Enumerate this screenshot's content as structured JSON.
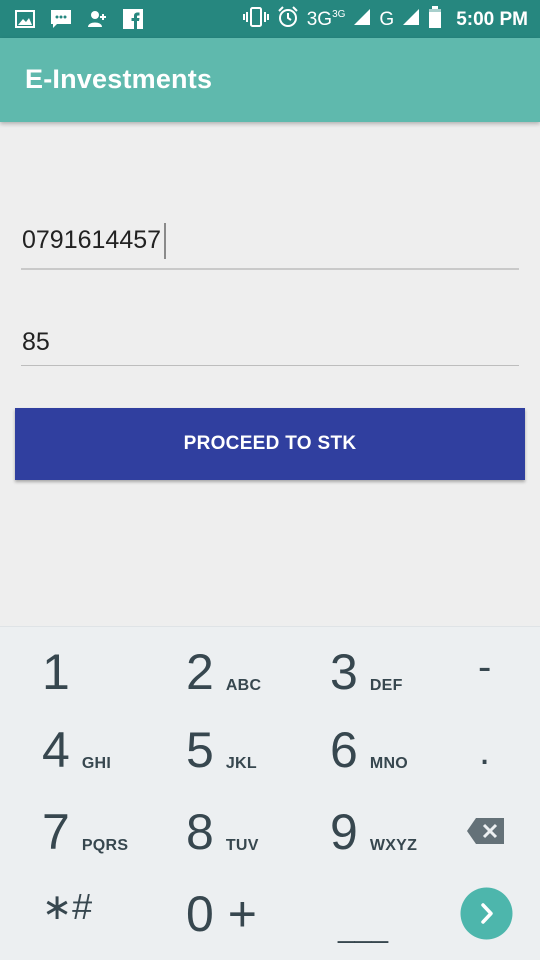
{
  "status_bar": {
    "network": "3G",
    "network_sup": "3G",
    "network2": "G",
    "time": "5:00 PM"
  },
  "app_bar": {
    "title": "E-Investments"
  },
  "form": {
    "phone_value": "0791614457",
    "amount_value": "85",
    "proceed_label": "PROCEED TO STK"
  },
  "keypad": {
    "k1": {
      "main": "1",
      "sub": ""
    },
    "k2": {
      "main": "2",
      "sub": "ABC"
    },
    "k3": {
      "main": "3",
      "sub": "DEF"
    },
    "k_minus": {
      "main": "-"
    },
    "k4": {
      "main": "4",
      "sub": "GHI"
    },
    "k5": {
      "main": "5",
      "sub": "JKL"
    },
    "k6": {
      "main": "6",
      "sub": "MNO"
    },
    "k_dot": {
      "main": "."
    },
    "k7": {
      "main": "7",
      "sub": "PQRS"
    },
    "k8": {
      "main": "8",
      "sub": "TUV"
    },
    "k9": {
      "main": "9",
      "sub": "WXYZ"
    },
    "k_star": {
      "main": "∗#"
    },
    "k0": {
      "main": "0 +"
    },
    "k_space": {
      "main": "___"
    }
  },
  "colors": {
    "status_bar": "#26877f",
    "app_bar": "#5fb9ad",
    "button": "#303f9f",
    "keypad_bg": "#eceff1",
    "enter_key": "#4db6ac"
  }
}
